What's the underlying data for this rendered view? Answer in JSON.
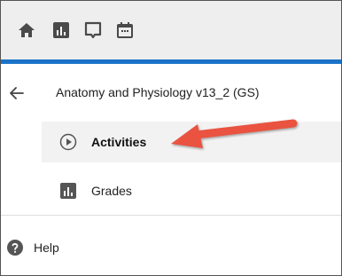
{
  "topbar": {
    "icons": [
      "home-icon",
      "reports-icon",
      "inbox-icon",
      "calendar-icon"
    ]
  },
  "course": {
    "title": "Anatomy and Physiology v13_2 (GS)"
  },
  "nav": {
    "items": [
      {
        "label": "Activities",
        "icon": "play-circle-icon",
        "selected": true
      },
      {
        "label": "Grades",
        "icon": "grades-icon",
        "selected": false
      }
    ]
  },
  "footer": {
    "help_label": "Help",
    "help_icon": "help-circle-icon"
  },
  "colors": {
    "accent_line": "#1a73c8",
    "callout_arrow": "#e9523f",
    "icon_dark": "#555555"
  }
}
